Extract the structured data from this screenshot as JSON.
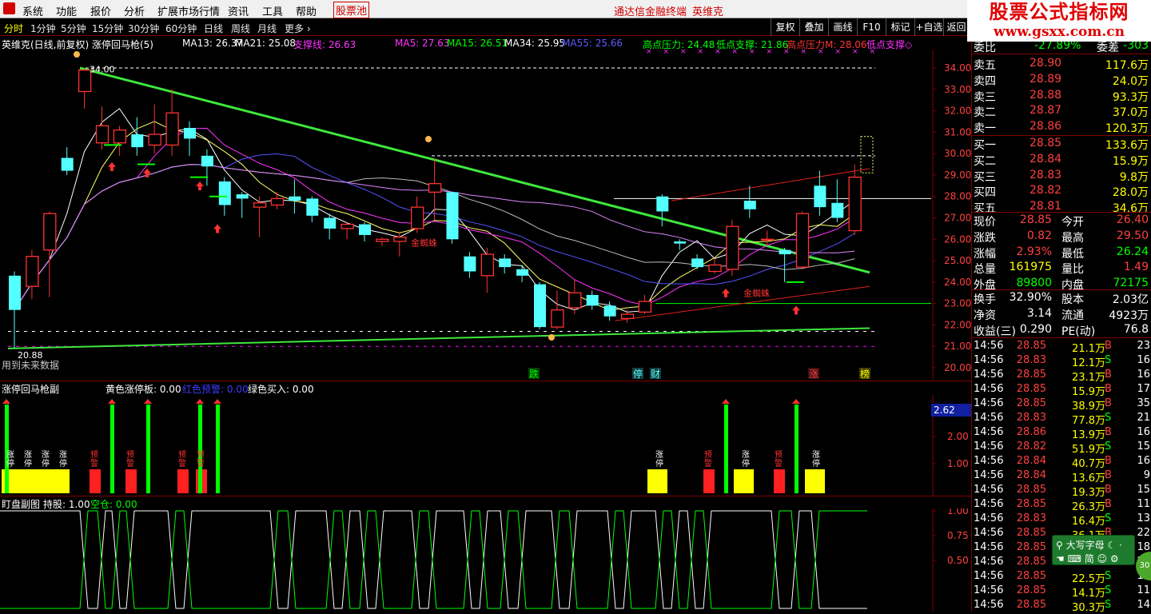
{
  "menubar": {
    "items": [
      "系统",
      "功能",
      "报价",
      "分析",
      "扩展市场行情",
      "资讯",
      "工具",
      "帮助"
    ],
    "highlight": "股票池",
    "center_title": "通达信金融终端",
    "stock_name": "英维克",
    "window_buttons": [
      "—",
      "▫",
      "✕"
    ]
  },
  "brand": {
    "line1": "股票公式指标网",
    "line2": "www.gsxx.com.cn"
  },
  "periods": [
    "分时",
    "1分钟",
    "5分钟",
    "15分钟",
    "30分钟",
    "60分钟",
    "日线",
    "周线",
    "月线",
    "更多 ›"
  ],
  "active_period": "日线",
  "toolbar": [
    "复权",
    "叠加",
    "画线",
    "F10",
    "标记",
    "+自选",
    "返回"
  ],
  "main_panel": {
    "title": "英维克(日线,前复权) 涨停回马枪(5)",
    "ma13": "MA13: 26.37",
    "ma21": "MA21: 25.08",
    "support": "支撑线: 26.63",
    "ma5": "MA5: 27.63",
    "ma15": "MA15: 26.51",
    "ma34": "MA34: 25.95",
    "ma55": "MA55: 25.66",
    "high_press": "高点压力: 24.48",
    "low_support": "低点支撑: 21.86",
    "high_press_m": "高点压力M: 28.06",
    "low_support_m": "低点支撑◇",
    "high_label": "34.00",
    "low_label": "20.88",
    "future_note": "用到未来数据",
    "spider_label": "金蜘蛛",
    "bottom_marks": [
      "跌",
      "停",
      "财",
      "涨",
      "榜"
    ],
    "price_axis": [
      "34.00",
      "33.00",
      "32.00",
      "31.00",
      "30.00",
      "29.00",
      "28.00",
      "27.00",
      "26.00",
      "25.00",
      "24.00",
      "23.00",
      "22.00",
      "21.00",
      "20.00"
    ]
  },
  "sub_panel": {
    "title": "涨停回马枪副",
    "yellow": "黄色涨停板: 0.00",
    "red": "红色预警: 0.00",
    "green": "绿色买入: 0.00",
    "axis": [
      "2.00",
      "1.00"
    ],
    "current": "2.62",
    "stamp_zt": "涨停",
    "stamp_yj": "预警"
  },
  "pos_panel": {
    "title": "盯盘副图",
    "hold": "持股: 1.00",
    "empty": "空仓: 0.00",
    "axis": [
      "1.00",
      "0.75",
      "0.50"
    ]
  },
  "quote": {
    "top": {
      "label": "委比",
      "val": "-27.89%",
      "label2": "委差",
      "val2": "-303"
    },
    "asks": [
      {
        "l": "卖五",
        "p": "28.90",
        "v": "117.6万"
      },
      {
        "l": "卖四",
        "p": "28.89",
        "v": "24.0万"
      },
      {
        "l": "卖三",
        "p": "28.88",
        "v": "93.3万"
      },
      {
        "l": "卖二",
        "p": "28.87",
        "v": "37.0万"
      },
      {
        "l": "卖一",
        "p": "28.86",
        "v": "120.3万"
      }
    ],
    "bids": [
      {
        "l": "买一",
        "p": "28.85",
        "v": "133.6万"
      },
      {
        "l": "买二",
        "p": "28.84",
        "v": "15.9万"
      },
      {
        "l": "买三",
        "p": "28.83",
        "v": "9.8万"
      },
      {
        "l": "买四",
        "p": "28.82",
        "v": "28.0万"
      },
      {
        "l": "买五",
        "p": "28.81",
        "v": "34.6万"
      }
    ],
    "stats": [
      {
        "l1": "现价",
        "v1": "28.85",
        "l2": "今开",
        "v2": "26.40"
      },
      {
        "l1": "涨跌",
        "v1": "0.82",
        "l2": "最高",
        "v2": "29.50"
      },
      {
        "l1": "涨幅",
        "v1": "2.93%",
        "l2": "最低",
        "v2": "26.24"
      },
      {
        "l1": "总量",
        "v1": "161975",
        "l2": "量比",
        "v2": "1.49"
      },
      {
        "l1": "外盘",
        "v1": "89800",
        "l2": "内盘",
        "v2": "72175"
      }
    ],
    "stats2": [
      {
        "l1": "换手",
        "v1": "32.90%",
        "l2": "股本",
        "v2": "2.03亿"
      },
      {
        "l1": "净资",
        "v1": "3.14",
        "l2": "流通",
        "v2": "4923万"
      },
      {
        "l1": "收益(三)",
        "v1": "0.290",
        "l2": "PE(动)",
        "v2": "76.8"
      }
    ],
    "ticks": [
      {
        "t": "14:56",
        "p": "28.85",
        "v": "21.1万",
        "s": "B",
        "n": "23"
      },
      {
        "t": "14:56",
        "p": "28.83",
        "v": "12.1万",
        "s": "S",
        "n": "16"
      },
      {
        "t": "14:56",
        "p": "28.85",
        "v": "23.1万",
        "s": "B",
        "n": "16"
      },
      {
        "t": "14:56",
        "p": "28.85",
        "v": "15.9万",
        "s": "B",
        "n": "17"
      },
      {
        "t": "14:56",
        "p": "28.85",
        "v": "38.9万",
        "s": "B",
        "n": "35"
      },
      {
        "t": "14:56",
        "p": "28.83",
        "v": "77.8万",
        "s": "S",
        "n": "21"
      },
      {
        "t": "14:56",
        "p": "28.86",
        "v": "13.9万",
        "s": "B",
        "n": "16"
      },
      {
        "t": "14:56",
        "p": "28.82",
        "v": "51.9万",
        "s": "S",
        "n": "15"
      },
      {
        "t": "14:56",
        "p": "28.84",
        "v": "40.7万",
        "s": "B",
        "n": "16"
      },
      {
        "t": "14:56",
        "p": "28.84",
        "v": "13.6万",
        "s": "B",
        "n": "9"
      },
      {
        "t": "14:56",
        "p": "28.85",
        "v": "19.3万",
        "s": "B",
        "n": "15"
      },
      {
        "t": "14:56",
        "p": "28.85",
        "v": "26.3万",
        "s": "B",
        "n": "11"
      },
      {
        "t": "14:56",
        "p": "28.83",
        "v": "16.4万",
        "s": "S",
        "n": "13"
      },
      {
        "t": "14:56",
        "p": "28.85",
        "v": "36.1万",
        "s": "B",
        "n": "22"
      },
      {
        "t": "14:56",
        "p": "28.85",
        "v": "",
        "s": "B",
        "n": "18"
      },
      {
        "t": "14:56",
        "p": "28.85",
        "v": "",
        "s": "B",
        "n": "25"
      },
      {
        "t": "14:56",
        "p": "28.85",
        "v": "22.5万",
        "s": "S",
        "n": "16"
      },
      {
        "t": "14:56",
        "p": "28.85",
        "v": "14.1万",
        "s": "S",
        "n": "11"
      },
      {
        "t": "14:56",
        "p": "28.85",
        "v": "30.3万",
        "s": "S",
        "n": "14"
      }
    ]
  },
  "ime": {
    "mode": "大写字母",
    "lang": "简",
    "badge": "30"
  },
  "colors": {
    "up": "#ff3232",
    "down": "#54ffff",
    "ma5": "#ffffff",
    "ma13": "#ffff00",
    "ma21": "#ff00ff",
    "ma34": "#00ff00",
    "trend": "#3ee83e",
    "yellow": "#ffff00",
    "green": "#00ff00"
  },
  "chart_data": {
    "type": "candlestick",
    "ylim": [
      20,
      34.5
    ],
    "candles": [
      [
        24.3,
        22.7,
        24.5,
        20.9
      ],
      [
        23.8,
        25.2,
        25.5,
        23.2
      ],
      [
        25.5,
        27.2,
        27.3,
        23.3
      ],
      [
        29.8,
        29.2,
        30.3,
        29.0
      ],
      [
        32.9,
        33.9,
        34.0,
        32.1
      ],
      [
        30.5,
        31.3,
        32.2,
        30.2
      ],
      [
        30.5,
        31.1,
        31.3,
        29.9
      ],
      [
        30.9,
        30.3,
        31.7,
        29.9
      ],
      [
        30.4,
        30.9,
        32.3,
        30.0
      ],
      [
        30.4,
        31.9,
        33.0,
        29.9
      ],
      [
        31.2,
        30.7,
        31.5,
        29.9
      ],
      [
        29.9,
        29.4,
        30.2,
        28.5
      ],
      [
        28.7,
        27.6,
        28.9,
        27.1
      ],
      [
        28.1,
        27.9,
        28.2,
        27.0
      ],
      [
        27.5,
        27.7,
        28.0,
        26.1
      ],
      [
        27.6,
        27.9,
        28.2,
        27.4
      ],
      [
        28.0,
        27.8,
        28.8,
        27.2
      ],
      [
        27.9,
        27.1,
        28.0,
        26.8
      ],
      [
        27.0,
        26.5,
        27.2,
        26.0
      ],
      [
        26.5,
        26.7,
        26.8,
        26.0
      ],
      [
        26.7,
        26.2,
        26.8,
        25.9
      ],
      [
        25.9,
        26.0,
        26.1,
        25.7
      ],
      [
        25.9,
        26.1,
        26.3,
        25.2
      ],
      [
        26.5,
        27.5,
        28.0,
        26.3
      ],
      [
        28.2,
        28.6,
        29.8,
        26.9
      ],
      [
        28.2,
        26.0,
        28.2,
        25.8
      ],
      [
        25.2,
        24.5,
        25.4,
        24.2
      ],
      [
        24.3,
        25.3,
        25.6,
        23.5
      ],
      [
        25.1,
        24.7,
        25.3,
        24.4
      ],
      [
        24.6,
        24.3,
        24.8,
        24.0
      ],
      [
        23.9,
        21.9,
        24.0,
        21.8
      ],
      [
        21.9,
        22.7,
        23.6,
        21.8
      ],
      [
        22.8,
        23.5,
        24.1,
        22.5
      ],
      [
        23.4,
        22.9,
        23.6,
        22.7
      ],
      [
        22.9,
        22.4,
        23.1,
        22.2
      ],
      [
        22.3,
        22.5,
        22.7,
        22.1
      ],
      [
        22.6,
        23.1,
        23.4,
        22.5
      ],
      [
        28.0,
        27.3,
        28.1,
        26.6
      ],
      [
        25.9,
        25.8,
        26.0,
        25.5
      ],
      [
        25.1,
        24.7,
        25.3,
        24.6
      ],
      [
        24.5,
        24.8,
        25.1,
        24.4
      ],
      [
        24.6,
        26.6,
        26.9,
        24.3
      ],
      [
        27.8,
        27.4,
        28.5,
        27.0
      ],
      [
        26.0,
        26.0,
        26.4,
        25.7
      ],
      [
        25.5,
        25.3,
        25.6,
        24.0
      ],
      [
        24.7,
        27.2,
        27.3,
        24.6
      ],
      [
        28.5,
        27.5,
        29.2,
        27.1
      ],
      [
        27.7,
        27.0,
        28.8,
        26.8
      ],
      [
        26.4,
        28.9,
        29.5,
        26.2
      ]
    ]
  }
}
